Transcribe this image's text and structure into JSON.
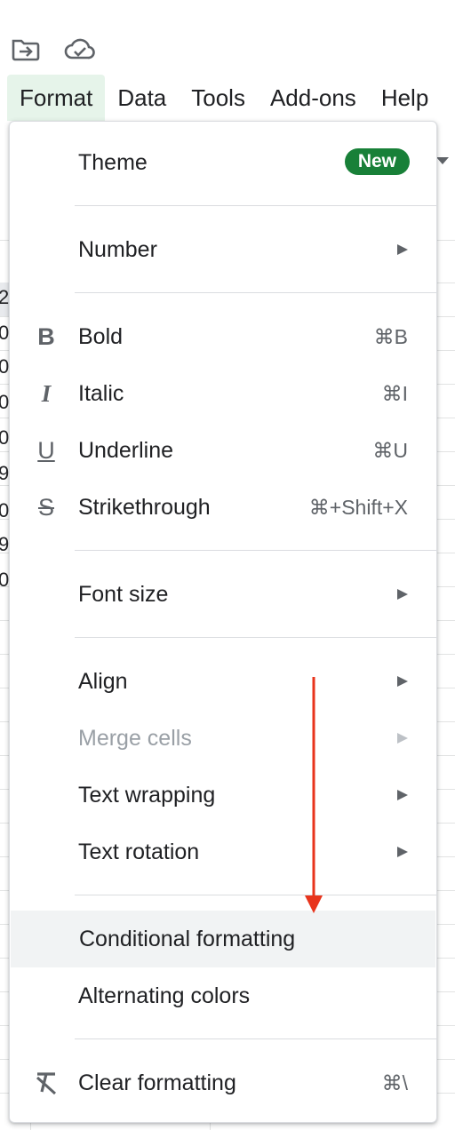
{
  "menubar": {
    "items": [
      {
        "label": "Format",
        "active": true
      },
      {
        "label": "Data"
      },
      {
        "label": "Tools"
      },
      {
        "label": "Add-ons"
      },
      {
        "label": "Help"
      }
    ]
  },
  "toolbar_icons": [
    "move-to-folder-icon",
    "cloud-saved-icon"
  ],
  "format_menu": {
    "theme": {
      "label": "Theme",
      "badge": "New"
    },
    "number": {
      "label": "Number"
    },
    "bold": {
      "label": "Bold",
      "shortcut": "⌘B",
      "icon": "B"
    },
    "italic": {
      "label": "Italic",
      "shortcut": "⌘I",
      "icon": "I"
    },
    "underline": {
      "label": "Underline",
      "shortcut": "⌘U",
      "icon": "U"
    },
    "strikethrough": {
      "label": "Strikethrough",
      "shortcut": "⌘+Shift+X",
      "icon": "S"
    },
    "font_size": {
      "label": "Font size"
    },
    "align": {
      "label": "Align"
    },
    "merge_cells": {
      "label": "Merge cells",
      "disabled": true
    },
    "text_wrapping": {
      "label": "Text wrapping"
    },
    "text_rotation": {
      "label": "Text rotation"
    },
    "conditional_formatting": {
      "label": "Conditional formatting",
      "highlighted": true
    },
    "alternating_colors": {
      "label": "Alternating colors"
    },
    "clear_formatting": {
      "label": "Clear formatting",
      "shortcut": "⌘\\"
    }
  },
  "background_cells": [
    "2",
    "0",
    "0",
    "0",
    "0",
    "9",
    "0",
    "9",
    "0"
  ],
  "colors": {
    "badge": "#188038",
    "highlight": "#f1f3f4",
    "active_menu": "#e6f4ea",
    "annotation_arrow": "#e8341c"
  }
}
